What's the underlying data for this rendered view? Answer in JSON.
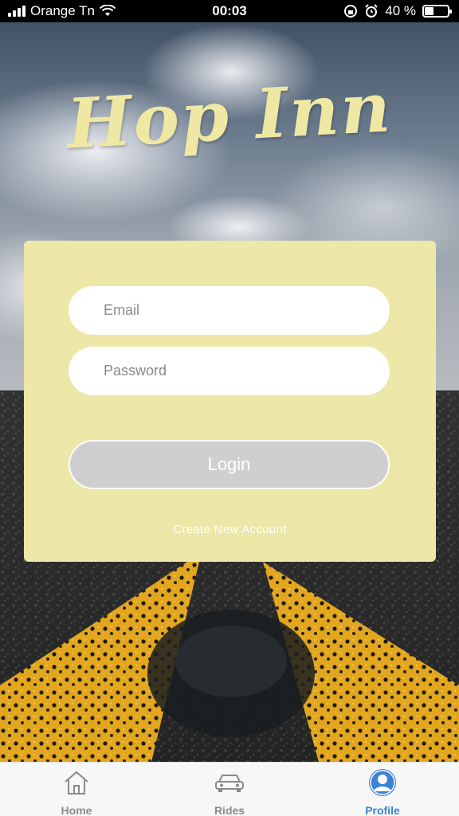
{
  "status_bar": {
    "carrier": "Orange Tn",
    "time": "00:03",
    "battery_percent": "40 %",
    "battery_level": 0.4
  },
  "app": {
    "logo_text": "Hop Inn"
  },
  "login_form": {
    "email_placeholder": "Email",
    "password_placeholder": "Password",
    "login_label": "Login",
    "create_account_label": "Create New Account"
  },
  "tab_bar": {
    "items": [
      {
        "label": "Home",
        "icon": "home-icon",
        "active": false
      },
      {
        "label": "Rides",
        "icon": "car-icon",
        "active": false
      },
      {
        "label": "Profile",
        "icon": "profile-icon",
        "active": true
      }
    ]
  },
  "colors": {
    "card": "#ede7a8",
    "logo": "#efe8a4",
    "active_tab": "#3b82d6",
    "button_disabled": "#cfcfcf"
  }
}
